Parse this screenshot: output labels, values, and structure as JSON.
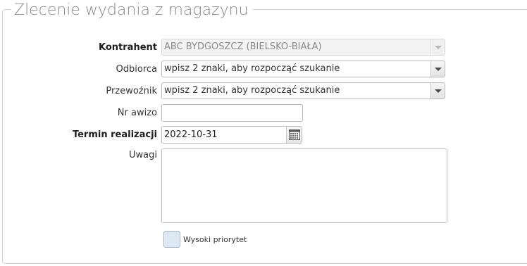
{
  "form": {
    "title": "Zlecenie wydania z magazynu",
    "fields": {
      "contractor": {
        "label": "Kontrahent",
        "value": "ABC BYDGOSZCZ (BIELSKO-BIAŁA)",
        "icon": "chevron-down-icon"
      },
      "recipient": {
        "label": "Odbiorca",
        "placeholder": "wpisz 2 znaki, aby rozpocząć szukanie",
        "icon": "chevron-down-icon"
      },
      "carrier": {
        "label": "Przewoźnik",
        "placeholder": "wpisz 2 znaki, aby rozpocząć szukanie",
        "icon": "chevron-down-icon"
      },
      "advice_no": {
        "label": "Nr awizo",
        "value": ""
      },
      "due_date": {
        "label": "Termin realizacji",
        "value": "2022-10-31",
        "icon": "calendar-icon"
      },
      "notes": {
        "label": "Uwagi",
        "value": ""
      },
      "high_priority": {
        "label": "Wysoki priorytet",
        "checked": false
      }
    }
  },
  "colors": {
    "checkbox_fill": "#dde8f3",
    "title_text": "#8a8a8a"
  }
}
